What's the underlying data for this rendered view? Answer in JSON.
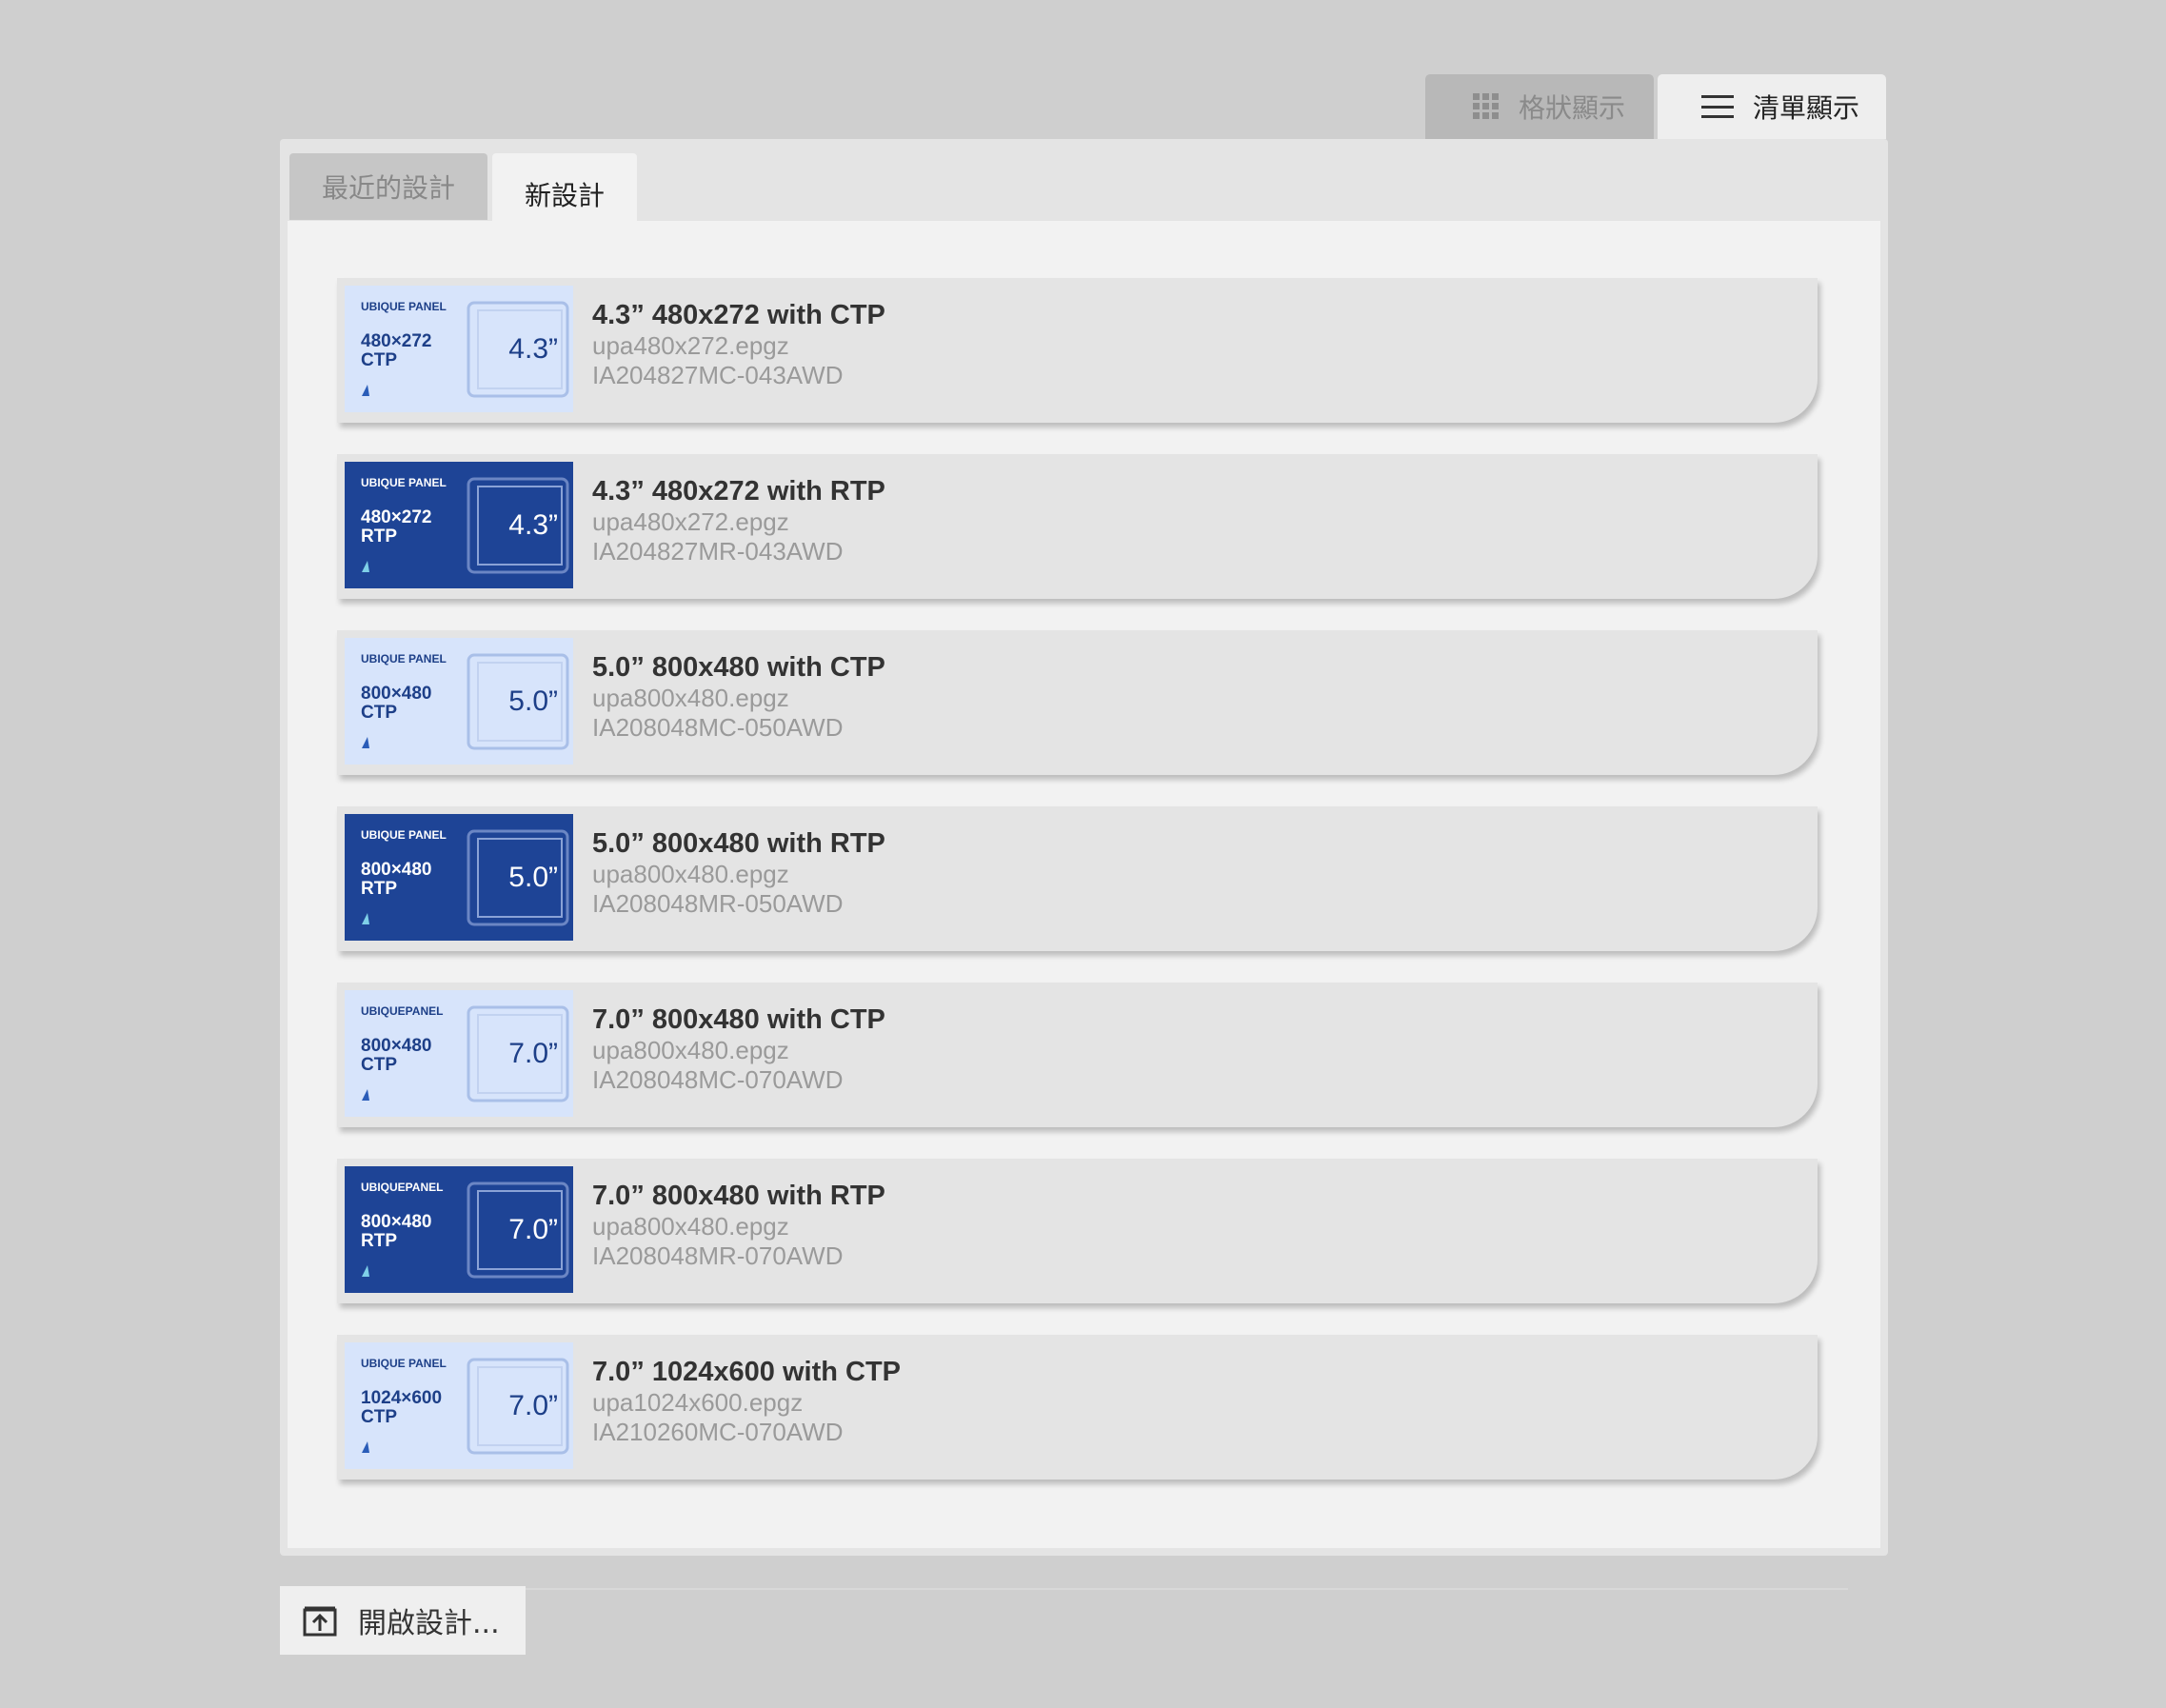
{
  "view_toggle": {
    "grid_label": "格狀顯示",
    "list_label": "清單顯示",
    "active": "list"
  },
  "tabs": {
    "recent": "最近的設計",
    "new": "新設計",
    "active": "new"
  },
  "designs": [
    {
      "title": "4.3” 480x272 with CTP",
      "file": "upa480x272.epgz",
      "model": "IA204827MC-043AWD",
      "thumb": {
        "style": "light",
        "res": "480×272",
        "touch": "CTP",
        "size": "4.3”",
        "brand": "UBIQUE PANEL"
      }
    },
    {
      "title": "4.3” 480x272 with RTP",
      "file": "upa480x272.epgz",
      "model": "IA204827MR-043AWD",
      "thumb": {
        "style": "dark",
        "res": "480×272",
        "touch": "RTP",
        "size": "4.3”",
        "brand": "UBIQUE PANEL"
      }
    },
    {
      "title": "5.0” 800x480 with CTP",
      "file": "upa800x480.epgz",
      "model": "IA208048MC-050AWD",
      "thumb": {
        "style": "light",
        "res": "800×480",
        "touch": "CTP",
        "size": "5.0”",
        "brand": "UBIQUE PANEL"
      }
    },
    {
      "title": "5.0” 800x480 with RTP",
      "file": "upa800x480.epgz",
      "model": "IA208048MR-050AWD",
      "thumb": {
        "style": "dark",
        "res": "800×480",
        "touch": "RTP",
        "size": "5.0”",
        "brand": "UBIQUE PANEL"
      }
    },
    {
      "title": "7.0” 800x480 with CTP",
      "file": "upa800x480.epgz",
      "model": "IA208048MC-070AWD",
      "thumb": {
        "style": "light",
        "res": "800×480",
        "touch": "CTP",
        "size": "7.0”",
        "brand": "UBIQUEPANEL"
      }
    },
    {
      "title": "7.0” 800x480 with RTP",
      "file": "upa800x480.epgz",
      "model": "IA208048MR-070AWD",
      "thumb": {
        "style": "dark",
        "res": "800×480",
        "touch": "RTP",
        "size": "7.0”",
        "brand": "UBIQUEPANEL"
      }
    },
    {
      "title": "7.0” 1024x600 with CTP",
      "file": "upa1024x600.epgz",
      "model": "IA210260MC-070AWD",
      "thumb": {
        "style": "light",
        "res": "1024×600",
        "touch": "CTP",
        "size": "7.0”",
        "brand": "UBIQUE PANEL"
      }
    }
  ],
  "open_button": {
    "label": "開啟設計..."
  },
  "colors": {
    "background": "#cfcfcf",
    "thumb_light": "#d7e4fb",
    "thumb_dark": "#1e4496",
    "brand_text": "#1d3f88"
  }
}
